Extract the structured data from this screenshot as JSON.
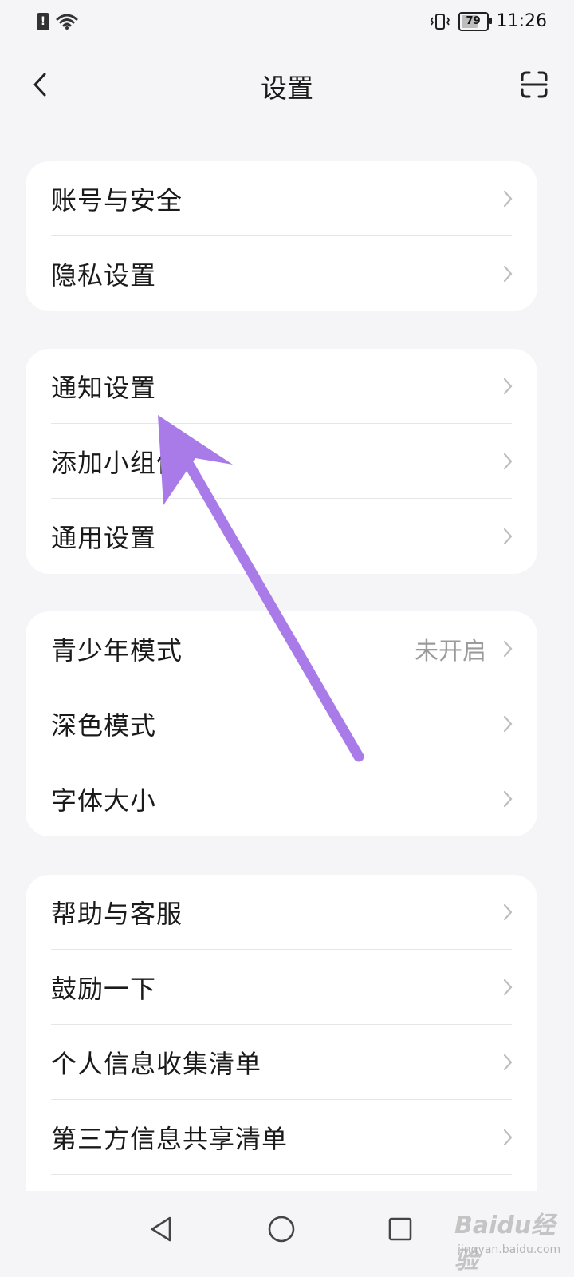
{
  "status_bar": {
    "time": "11:26",
    "battery_level": "79",
    "battery_fraction": 0.79,
    "icons": [
      "alert-icon",
      "wifi-icon",
      "vibrate-icon",
      "battery-icon"
    ]
  },
  "header": {
    "title": "设置",
    "back_icon": "chevron-left-icon",
    "scan_icon": "scan-icon"
  },
  "groups": [
    {
      "items": [
        {
          "label": "账号与安全",
          "value": ""
        },
        {
          "label": "隐私设置",
          "value": ""
        }
      ]
    },
    {
      "items": [
        {
          "label": "通知设置",
          "value": ""
        },
        {
          "label": "添加小组件",
          "value": ""
        },
        {
          "label": "通用设置",
          "value": ""
        }
      ]
    },
    {
      "items": [
        {
          "label": "青少年模式",
          "value": "未开启"
        },
        {
          "label": "深色模式",
          "value": ""
        },
        {
          "label": "字体大小",
          "value": ""
        }
      ]
    },
    {
      "items": [
        {
          "label": "帮助与客服",
          "value": ""
        },
        {
          "label": "鼓励一下",
          "value": ""
        },
        {
          "label": "个人信息收集清单",
          "value": ""
        },
        {
          "label": "第三方信息共享清单",
          "value": ""
        }
      ]
    }
  ],
  "nav_bar": {
    "buttons": [
      "back-triangle-icon",
      "home-circle-icon",
      "recents-square-icon"
    ]
  },
  "annotation": {
    "color": "#a97be8",
    "points_to": "通知设置"
  },
  "watermark": {
    "main": "Baidu经验",
    "sub": "jingyan.baidu.com"
  }
}
